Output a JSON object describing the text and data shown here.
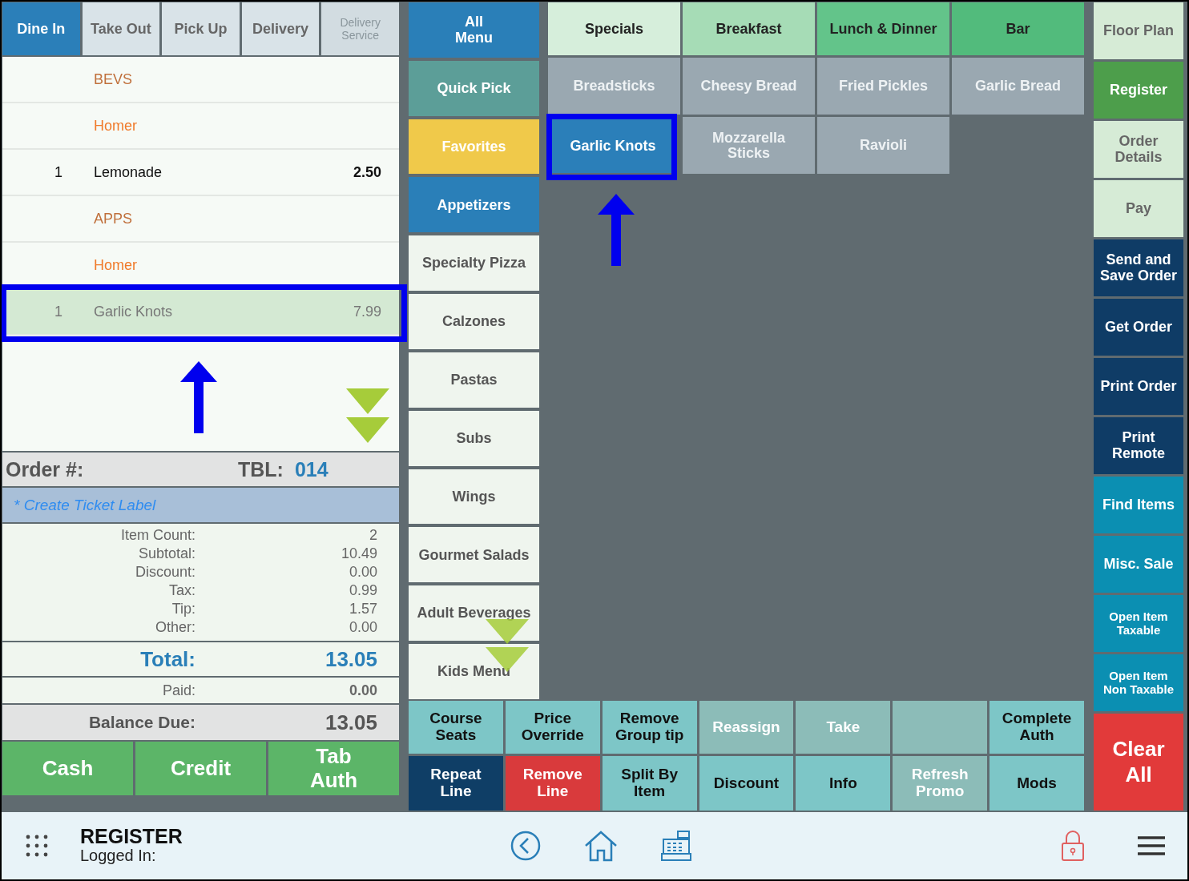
{
  "order_type_tabs": [
    {
      "label": "Dine In",
      "selected": true,
      "disabled": false
    },
    {
      "label": "Take Out",
      "selected": false,
      "disabled": false
    },
    {
      "label": "Pick Up",
      "selected": false,
      "disabled": false
    },
    {
      "label": "Delivery",
      "selected": false,
      "disabled": false
    },
    {
      "label": "Delivery Service",
      "selected": false,
      "disabled": true
    }
  ],
  "order_lines": [
    {
      "kind": "group",
      "name": "BEVS"
    },
    {
      "kind": "seat",
      "name": "Homer"
    },
    {
      "kind": "item",
      "qty": "1",
      "name": "Lemonade",
      "price": "2.50",
      "selected": false,
      "highlighted": false
    },
    {
      "kind": "group",
      "name": "APPS"
    },
    {
      "kind": "seat",
      "name": "Homer"
    },
    {
      "kind": "item",
      "qty": "1",
      "name": "Garlic Knots",
      "price": "7.99",
      "selected": true,
      "highlighted": true
    }
  ],
  "order_header": {
    "label": "Order #:",
    "table_label": "TBL:",
    "table": "014"
  },
  "ticket_label": "* Create Ticket Label",
  "summary": [
    {
      "label": "Item Count:",
      "value": "2"
    },
    {
      "label": "Subtotal:",
      "value": "10.49"
    },
    {
      "label": "Discount:",
      "value": "0.00"
    },
    {
      "label": "Tax:",
      "value": "0.99"
    },
    {
      "label": "Tip:",
      "value": "1.57"
    },
    {
      "label": "Other:",
      "value": "0.00"
    }
  ],
  "total": {
    "label": "Total:",
    "value": "13.05"
  },
  "paid": {
    "label": "Paid:",
    "value": "0.00"
  },
  "balance_due": {
    "label": "Balance Due:",
    "value": "13.05"
  },
  "payment_buttons": [
    "Cash",
    "Credit",
    "Tab Auth"
  ],
  "menu_tabs": [
    {
      "label": "Specials",
      "color": "#d6eedb"
    },
    {
      "label": "Breakfast",
      "color": "#a6dcb6"
    },
    {
      "label": "Lunch & Dinner",
      "color": "#63c48a"
    },
    {
      "label": "Bar",
      "color": "#52bb7c"
    }
  ],
  "categories": [
    {
      "label": "All Menu",
      "color": "#2a7fb8"
    },
    {
      "label": "Quick Pick",
      "color": "#5c9e98"
    },
    {
      "label": "Favorites",
      "color": "#f0c94a"
    },
    {
      "label": "Appetizers",
      "color": "#2a7fb8"
    },
    {
      "label": "Specialty Pizza",
      "color": "#eff5ee"
    },
    {
      "label": "Calzones",
      "color": "#eff5ee"
    },
    {
      "label": "Pastas",
      "color": "#eff5ee"
    },
    {
      "label": "Subs",
      "color": "#eff5ee"
    },
    {
      "label": "Wings",
      "color": "#eff5ee"
    },
    {
      "label": "Gourmet Salads",
      "color": "#eff5ee"
    },
    {
      "label": "Adult Beverages",
      "color": "#eff5ee"
    },
    {
      "label": "Kids Menu",
      "color": "#eff5ee"
    }
  ],
  "menu_items": [
    {
      "label": "Breadsticks",
      "selected": false,
      "highlighted": false
    },
    {
      "label": "Cheesy Bread",
      "selected": false,
      "highlighted": false
    },
    {
      "label": "Fried Pickles",
      "selected": false,
      "highlighted": false
    },
    {
      "label": "Garlic Bread",
      "selected": false,
      "highlighted": false
    },
    {
      "label": "Garlic Knots",
      "selected": true,
      "highlighted": true
    },
    {
      "label": "Mozzarella Sticks",
      "selected": false,
      "highlighted": false
    },
    {
      "label": "Ravioli",
      "selected": false,
      "highlighted": false
    }
  ],
  "actions": [
    {
      "label": "Course Seats",
      "color": "#7dc6c7",
      "disabled": false
    },
    {
      "label": "Price Override",
      "color": "#7dc6c7",
      "disabled": false
    },
    {
      "label": "Remove Group tip",
      "color": "#7dc6c7",
      "disabled": false
    },
    {
      "label": "Reassign",
      "disabled": true
    },
    {
      "label": "Take",
      "disabled": true
    },
    {
      "disabled": true
    },
    {
      "label": "Complete Auth",
      "color": "#7dc6c7",
      "disabled": false
    },
    {
      "label": "Repeat Line",
      "color": "#0f3e66",
      "disabled": false
    },
    {
      "label": "Remove Line",
      "color": "#d93a3c",
      "disabled": false
    },
    {
      "label": "Split By Item",
      "color": "#7dc6c7",
      "disabled": false
    },
    {
      "label": "Discount",
      "color": "#7dc6c7",
      "disabled": false
    },
    {
      "label": "Info",
      "color": "#7dc6c7",
      "disabled": false
    },
    {
      "label": "Refresh Promo",
      "disabled": true
    },
    {
      "label": "Mods",
      "color": "#7dc6c7",
      "disabled": false
    }
  ],
  "side_buttons": [
    {
      "label": "Floor Plan",
      "color": "#d6ebd6"
    },
    {
      "label": "Register",
      "color": "#4d9e4b"
    },
    {
      "label": "Order Details",
      "color": "#d6ebd6"
    },
    {
      "label": "Pay",
      "color": "#d6ebd6"
    },
    {
      "label": "Send and Save Order",
      "color": "#0f3c66"
    },
    {
      "label": "Get Order",
      "color": "#0f3c66"
    },
    {
      "label": "Print Order",
      "color": "#0f3c66"
    },
    {
      "label": "Print Remote",
      "color": "#0f3c66"
    },
    {
      "label": "Find Items",
      "color": "#0b8fb2"
    },
    {
      "label": "Misc. Sale",
      "color": "#0b8fb2"
    },
    {
      "label": "Open Item Taxable",
      "color": "#0b8fb2"
    },
    {
      "label": "Open Item Non Taxable",
      "color": "#0b8fb2"
    }
  ],
  "clear_button": "Clear All",
  "footer": {
    "title": "REGISTER",
    "subtitle": "Logged In:"
  }
}
